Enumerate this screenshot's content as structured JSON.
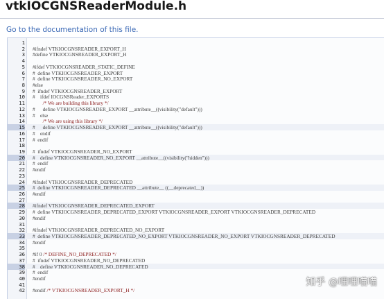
{
  "header": {
    "title": "vtkIOCGNSReaderModule.h",
    "doc_link": "Go to the documentation of this file."
  },
  "code": {
    "highlighted_lines": [
      15,
      20,
      25,
      28,
      33,
      38
    ],
    "lines": [
      {
        "n": "1",
        "pre": "",
        "cm": ""
      },
      {
        "n": "2",
        "pre": "#ifndef VTKIOCGNSREADER_EXPORT_H",
        "cm": ""
      },
      {
        "n": "3",
        "pre": "#define VTKIOCGNSREADER_EXPORT_H",
        "cm": ""
      },
      {
        "n": "4",
        "pre": "",
        "cm": ""
      },
      {
        "n": "5",
        "pre": "#ifdef VTKIOCGNSREADER_STATIC_DEFINE",
        "cm": ""
      },
      {
        "n": "6",
        "pre": "#  define VTKIOCGNSREADER_EXPORT",
        "cm": ""
      },
      {
        "n": "7",
        "pre": "#  define VTKIOCGNSREADER_NO_EXPORT",
        "cm": ""
      },
      {
        "n": "8",
        "pre": "#else",
        "cm": ""
      },
      {
        "n": "9",
        "pre": "#  ifndef VTKIOCGNSREADER_EXPORT",
        "cm": ""
      },
      {
        "n": "10",
        "pre": "#    ifdef IOCGNSReader_EXPORTS",
        "cm": ""
      },
      {
        "n": "11",
        "pre": "        ",
        "cm": "/* We are building this library */"
      },
      {
        "n": "12",
        "pre": "#      define VTKIOCGNSREADER_EXPORT __attribute__((visibility(\"default\")))",
        "cm": ""
      },
      {
        "n": "13",
        "pre": "#    else",
        "cm": ""
      },
      {
        "n": "14",
        "pre": "        ",
        "cm": "/* We are using this library */"
      },
      {
        "n": "15",
        "pre": "#      define VTKIOCGNSREADER_EXPORT __attribute__((visibility(\"default\")))",
        "cm": ""
      },
      {
        "n": "16",
        "pre": "#    endif",
        "cm": ""
      },
      {
        "n": "17",
        "pre": "#  endif",
        "cm": ""
      },
      {
        "n": "18",
        "pre": "",
        "cm": ""
      },
      {
        "n": "19",
        "pre": "#  ifndef VTKIOCGNSREADER_NO_EXPORT",
        "cm": ""
      },
      {
        "n": "20",
        "pre": "#    define VTKIOCGNSREADER_NO_EXPORT __attribute__((visibility(\"hidden\")))",
        "cm": ""
      },
      {
        "n": "21",
        "pre": "#  endif",
        "cm": ""
      },
      {
        "n": "22",
        "pre": "#endif",
        "cm": ""
      },
      {
        "n": "23",
        "pre": "",
        "cm": ""
      },
      {
        "n": "24",
        "pre": "#ifndef VTKIOCGNSREADER_DEPRECATED",
        "cm": ""
      },
      {
        "n": "25",
        "pre": "#  define VTKIOCGNSREADER_DEPRECATED __attribute__ ((__deprecated__))",
        "cm": ""
      },
      {
        "n": "26",
        "pre": "#endif",
        "cm": ""
      },
      {
        "n": "27",
        "pre": "",
        "cm": ""
      },
      {
        "n": "28",
        "pre": "#ifndef VTKIOCGNSREADER_DEPRECATED_EXPORT",
        "cm": ""
      },
      {
        "n": "29",
        "pre": "#  define VTKIOCGNSREADER_DEPRECATED_EXPORT VTKIOCGNSREADER_EXPORT VTKIOCGNSREADER_DEPRECATED",
        "cm": ""
      },
      {
        "n": "30",
        "pre": "#endif",
        "cm": ""
      },
      {
        "n": "31",
        "pre": "",
        "cm": ""
      },
      {
        "n": "32",
        "pre": "#ifndef VTKIOCGNSREADER_DEPRECATED_NO_EXPORT",
        "cm": ""
      },
      {
        "n": "33",
        "pre": "#  define VTKIOCGNSREADER_DEPRECATED_NO_EXPORT VTKIOCGNSREADER_NO_EXPORT VTKIOCGNSREADER_DEPRECATED",
        "cm": ""
      },
      {
        "n": "34",
        "pre": "#endif",
        "cm": ""
      },
      {
        "n": "35",
        "pre": "",
        "cm": ""
      },
      {
        "n": "36",
        "pre": "#if 0 ",
        "cm": "/* DEFINE_NO_DEPRECATED */"
      },
      {
        "n": "37",
        "pre": "#  ifndef VTKIOCGNSREADER_NO_DEPRECATED",
        "cm": ""
      },
      {
        "n": "38",
        "pre": "#    define VTKIOCGNSREADER_NO_DEPRECATED",
        "cm": ""
      },
      {
        "n": "39",
        "pre": "#  endif",
        "cm": ""
      },
      {
        "n": "40",
        "pre": "#endif",
        "cm": ""
      },
      {
        "n": "41",
        "pre": "",
        "cm": ""
      },
      {
        "n": "42",
        "pre": "#endif ",
        "cm": "/* VTKIOCGNSREADER_EXPORT_H */"
      }
    ]
  },
  "watermark": "知乎 @哩哩喵喵",
  "colors": {
    "link": "#3a68b5",
    "comment": "#8b1a1a",
    "gutter_highlight": "#c8d1e4",
    "frame_border": "#c4cfe5"
  }
}
